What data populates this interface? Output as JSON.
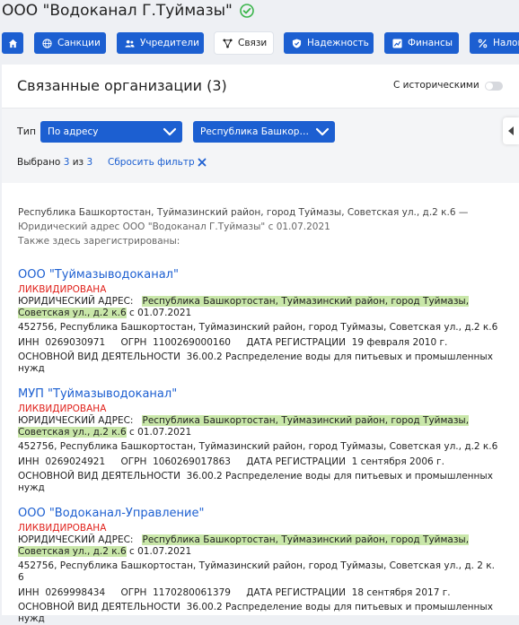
{
  "header": {
    "title": "ООО \"Водоканал Г.Туймазы\""
  },
  "nav": [
    {
      "label": "",
      "icon": "home-icon"
    },
    {
      "label": "Санкции",
      "icon": "globe-icon"
    },
    {
      "label": "Учредители",
      "icon": "users-icon"
    },
    {
      "label": "Связи",
      "icon": "network-icon",
      "active": true
    },
    {
      "label": "Надежность",
      "icon": "shield-icon"
    },
    {
      "label": "Финансы",
      "icon": "chart-icon"
    },
    {
      "label": "Налоги",
      "icon": "percent-icon"
    }
  ],
  "card": {
    "title": "Связанные организации (3)",
    "historical_label": "С историческими"
  },
  "filter": {
    "type_label": "Тип",
    "type_value": "По адресу",
    "region_value": "Республика Башкортостан",
    "selected_label": "Выбрано",
    "selected_count": "3",
    "of_label": "из",
    "total_count": "3",
    "reset_label": "Сбросить фильтр"
  },
  "address_info": {
    "line1": "Республика Башкортостан, Туймазинский район, город Туймазы, Советская ул., д.2 к.6 —",
    "line2": "Юридический адрес ООО \"Водоканал Г.Туймазы\" с 01.07.2021",
    "line3": "Также здесь зарегистрированы:"
  },
  "labels": {
    "legal_address": "ЮРИДИЧЕСКИЙ АДРЕС:",
    "since": "с 01.07.2021",
    "inn": "ИНН",
    "ogrn": "ОГРН",
    "reg_date": "ДАТА РЕГИСТРАЦИИ",
    "activity": "ОСНОВНОЙ ВИД ДЕЯТЕЛЬНОСТИ"
  },
  "orgs": [
    {
      "name": "ООО \"Туймазыводоканал\"",
      "status": "ЛИКВИДИРОВАНА",
      "address_hl_1": "Республика Башкортостан, Туймазинский район, город Туймазы,",
      "address_hl_2": "Советская ул., д.2 к.6",
      "postal_address": "452756, Республика Башкортостан, Туймазинский район, город Туймазы, Советская ул., д.2 к.6",
      "inn": "0269030971",
      "ogrn": "1100269000160",
      "reg_date": "19 февраля 2010 г.",
      "activity_1": "36.00.2 Распределение воды для питьевых и промышленных",
      "activity_2": "нужд"
    },
    {
      "name": "МУП \"Туймазыводоканал\"",
      "status": "ЛИКВИДИРОВАНА",
      "address_hl_1": "Республика Башкортостан, Туймазинский район, город Туймазы,",
      "address_hl_2": "Советская ул., д.2 к.6",
      "postal_address": "452756, Республика Башкортостан, Туймазинский район, город Туймазы, Советская ул., д.2 к.6",
      "inn": "0269024921",
      "ogrn": "1060269017863",
      "reg_date": "1 сентября 2006 г.",
      "activity_1": "36.00.2 Распределение воды для питьевых и промышленных",
      "activity_2": "нужд"
    },
    {
      "name": "ООО \"Водоканал-Управление\"",
      "status": "ЛИКВИДИРОВАНА",
      "address_hl_1": "Республика Башкортостан, Туймазинский район, город Туймазы,",
      "address_hl_2": "Советская ул., д.2 к.6",
      "postal_address": "452756, Республика Башкортостан, Туймазинский район, город Туймазы, Советская ул., д. 2 к. 6",
      "inn": "0269998434",
      "ogrn": "1170280061379",
      "reg_date": "18 сентября 2017 г.",
      "activity_1": "36.00.2 Распределение воды для питьевых и промышленных",
      "activity_2": "нужд"
    }
  ],
  "colors": {
    "accent": "#1c5fd1",
    "danger": "#e0211b",
    "highlight": "#c9e7a9",
    "check": "#3ab54a"
  }
}
